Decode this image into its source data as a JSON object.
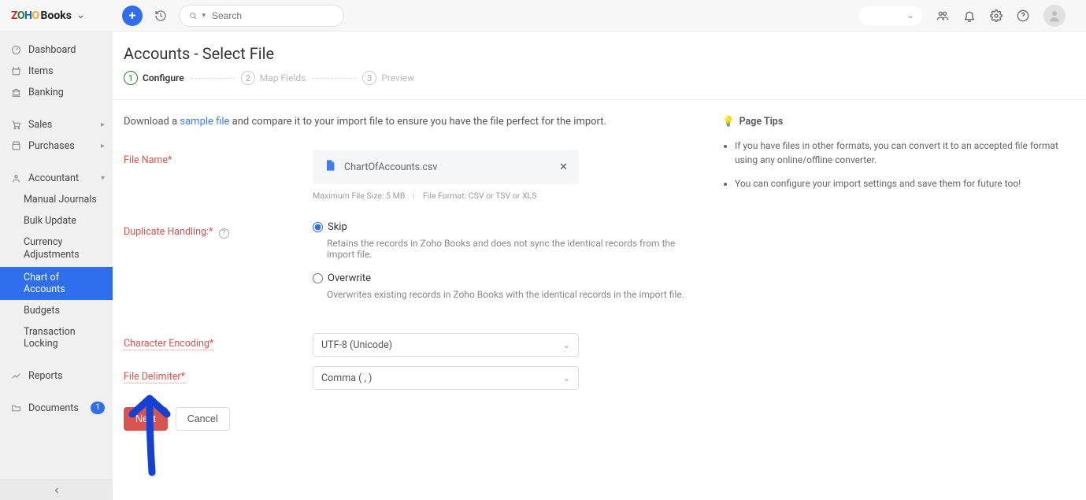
{
  "brand": {
    "books": "Books"
  },
  "topbar": {
    "search_placeholder": "Search",
    "org_caret": "⌄"
  },
  "sidebar": {
    "dashboard": "Dashboard",
    "items": "Items",
    "banking": "Banking",
    "sales": "Sales",
    "purchases": "Purchases",
    "accountant": "Accountant",
    "sub": {
      "manual_journals": "Manual Journals",
      "bulk_update": "Bulk Update",
      "currency_adjustments": "Currency Adjustments",
      "chart_of_accounts": "Chart of Accounts",
      "budgets": "Budgets",
      "transaction_locking": "Transaction Locking"
    },
    "reports": "Reports",
    "documents": "Documents",
    "documents_badge": "1"
  },
  "page": {
    "title": "Accounts - Select File",
    "steps": {
      "s1": "Configure",
      "s2": "Map Fields",
      "s3": "Preview"
    },
    "helper_prefix": "Download a ",
    "helper_link": "sample file",
    "helper_suffix": " and compare it to your import file to ensure you have the file perfect for the import.",
    "labels": {
      "file_name": "File Name*",
      "duplicate_handling": "Duplicate Handling:*",
      "character_encoding": "Character Encoding*",
      "file_delimiter": "File Delimiter*"
    },
    "file": {
      "name": "ChartOfAccounts.csv",
      "hint_size": "Maximum File Size: 5 MB",
      "hint_format": "File Format: CSV or TSV or XLS"
    },
    "dup": {
      "skip_label": "Skip",
      "skip_desc": "Retains the records in Zoho Books and does not sync the identical records from the import file.",
      "overwrite_label": "Overwrite",
      "overwrite_desc": "Overwrites existing records in Zoho Books with the identical records in the import file."
    },
    "encoding_value": "UTF-8 (Unicode)",
    "delimiter_value": "Comma ( , )",
    "buttons": {
      "next": "Next",
      "cancel": "Cancel"
    },
    "tips": {
      "title": "Page Tips",
      "t1": "If you have files in other formats, you can convert it to an accepted file format using any online/offline converter.",
      "t2": "You can configure your import settings and save them for future too!"
    }
  }
}
